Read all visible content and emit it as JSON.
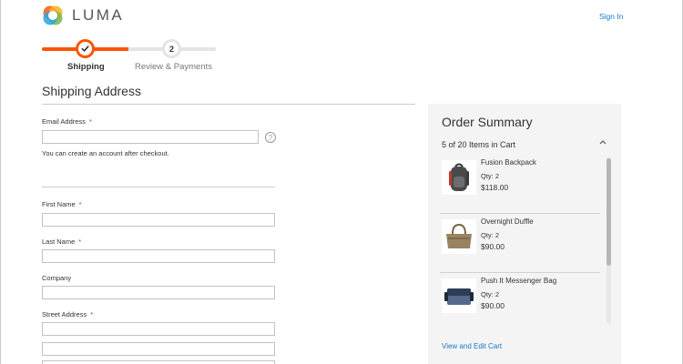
{
  "header": {
    "logo_text": "LUMA",
    "signin_label": "Sign In"
  },
  "progress": {
    "steps": [
      {
        "label": "Shipping",
        "number": "",
        "state": "complete"
      },
      {
        "label": "Review & Payments",
        "number": "2",
        "state": "pending"
      }
    ],
    "accent_color": "#ff5501"
  },
  "shipping": {
    "title": "Shipping Address",
    "required_marker": "*",
    "email": {
      "label": "Email Address",
      "value": "",
      "placeholder": ""
    },
    "account_note": "You can create an account after checkout.",
    "first_name": {
      "label": "First Name",
      "value": ""
    },
    "last_name": {
      "label": "Last Name",
      "value": ""
    },
    "company": {
      "label": "Company",
      "value": ""
    },
    "street": {
      "label": "Street Address",
      "line1": "",
      "line2": ""
    }
  },
  "summary": {
    "title": "Order Summary",
    "count_text": "5 of 20 Items in Cart",
    "items": [
      {
        "name": "Fusion Backpack",
        "qty": "Qty: 2",
        "price": "$118.00",
        "image": "backpack"
      },
      {
        "name": "Overnight Duffle",
        "qty": "Qty: 2",
        "price": "$90.00",
        "image": "duffle-bag"
      },
      {
        "name": "Push It Messenger Bag",
        "qty": "Qty: 2",
        "price": "$90.00",
        "image": "messenger-bag"
      }
    ],
    "edit_cart_label": "View and Edit Cart"
  },
  "colors": {
    "link": "#1979c3",
    "required": "#e02b27",
    "summary_bg": "#f4f4f4"
  }
}
